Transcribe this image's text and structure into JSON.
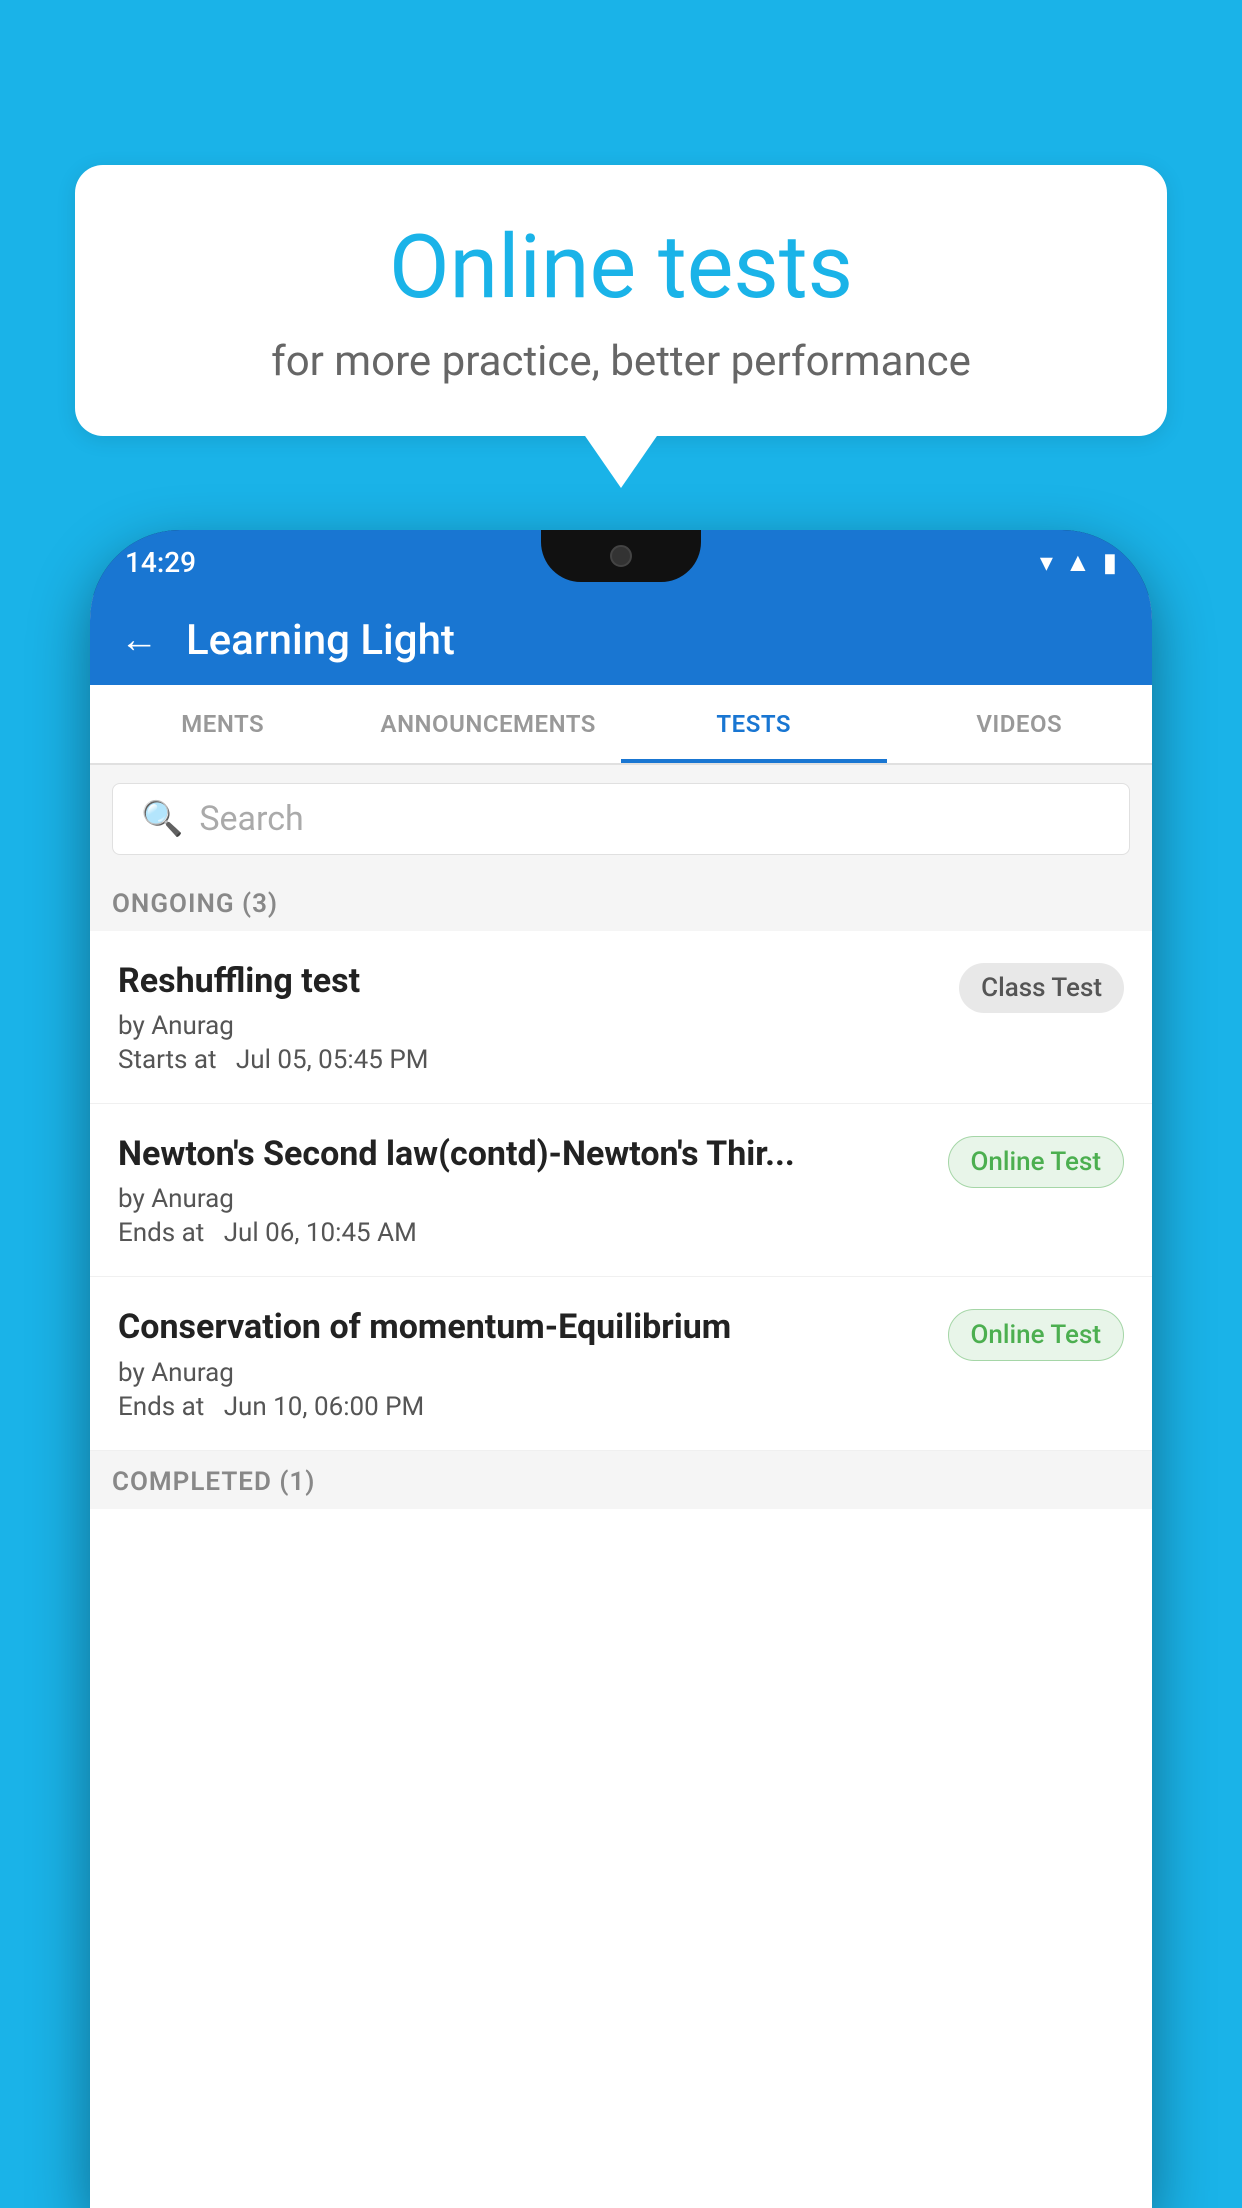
{
  "background_color": "#1ab3e8",
  "speech_bubble": {
    "title": "Online tests",
    "subtitle": "for more practice, better performance"
  },
  "phone": {
    "status_bar": {
      "time": "14:29",
      "icons": [
        "wifi",
        "signal",
        "battery"
      ]
    },
    "app_header": {
      "back_label": "←",
      "title": "Learning Light"
    },
    "tabs": [
      {
        "label": "MENTS",
        "active": false
      },
      {
        "label": "ANNOUNCEMENTS",
        "active": false
      },
      {
        "label": "TESTS",
        "active": true
      },
      {
        "label": "VIDEOS",
        "active": false
      }
    ],
    "search": {
      "placeholder": "Search",
      "icon": "🔍"
    },
    "ongoing_section": {
      "label": "ONGOING (3)",
      "tests": [
        {
          "name": "Reshuffling test",
          "author": "by Anurag",
          "time_label": "Starts at",
          "time": "Jul 05, 05:45 PM",
          "badge": "Class Test",
          "badge_type": "class"
        },
        {
          "name": "Newton's Second law(contd)-Newton's Thir...",
          "author": "by Anurag",
          "time_label": "Ends at",
          "time": "Jul 06, 10:45 AM",
          "badge": "Online Test",
          "badge_type": "online"
        },
        {
          "name": "Conservation of momentum-Equilibrium",
          "author": "by Anurag",
          "time_label": "Ends at",
          "time": "Jun 10, 06:00 PM",
          "badge": "Online Test",
          "badge_type": "online"
        }
      ]
    },
    "completed_section": {
      "label": "COMPLETED (1)"
    }
  }
}
